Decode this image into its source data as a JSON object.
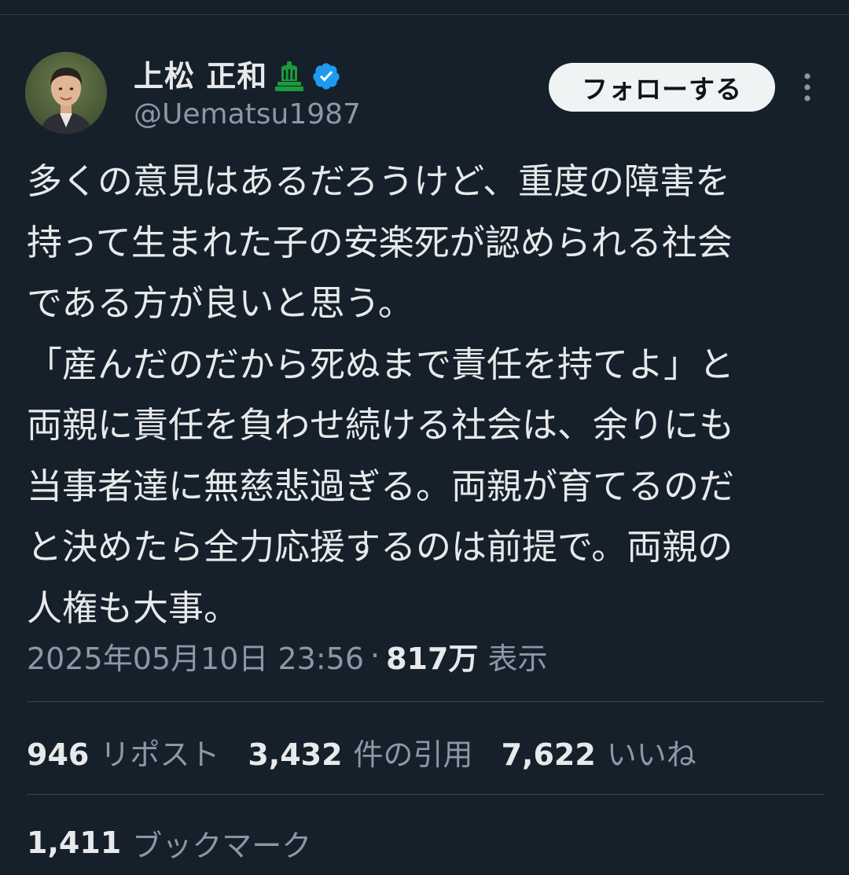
{
  "author": {
    "display_name": "上松 正和",
    "handle": "@Uematsu1987",
    "party_icon": "party-emblem-icon",
    "verified_icon": "verified-badge-icon"
  },
  "header": {
    "follow_label": "フォローする",
    "more_icon": "more-vertical-icon"
  },
  "tweet": {
    "lines": [
      "多くの意見はあるだろうけど、重度の障害を",
      "持って生まれた子の安楽死が認められる社会",
      "である方が良いと思う。",
      "「産んだのだから死ぬまで責任を持てよ」と",
      "両親に責任を負わせ続ける社会は、余りにも",
      "当事者達に無慈悲過ぎる。両親が育てるのだ",
      "と決めたら全力応援するのは前提で。両親の",
      "人権も大事。"
    ],
    "timestamp": "2025年05月10日 23:56",
    "separator": "·",
    "views_count": "817万",
    "views_label": "表示"
  },
  "stats": {
    "reposts_count": "946",
    "reposts_label": "リポスト",
    "quotes_count": "3,432",
    "quotes_label": "件の引用",
    "likes_count": "7,622",
    "likes_label": "いいね",
    "bookmarks_count": "1,411",
    "bookmarks_label": "ブックマーク"
  },
  "colors": {
    "background": "#15202b",
    "text": "#e7e9ea",
    "secondary_text": "#8b98a5",
    "verified_blue": "#1d9bf0",
    "party_green": "#1a9b3c"
  }
}
